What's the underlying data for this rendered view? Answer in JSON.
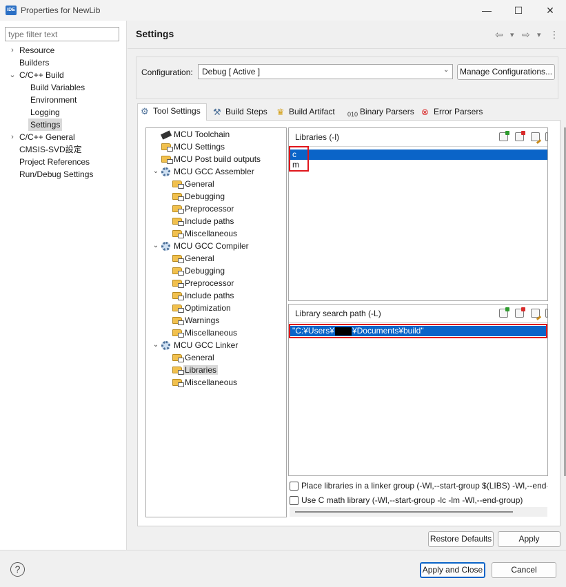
{
  "window": {
    "app_icon_text": "IDE",
    "title": "Properties for NewLib",
    "minimize_glyph": "—",
    "maximize_glyph": "☐",
    "close_glyph": "✕"
  },
  "filter": {
    "placeholder": "type filter text"
  },
  "nav": {
    "items": [
      {
        "label": "Resource",
        "arrow": "›"
      },
      {
        "label": "Builders",
        "arrow": ""
      },
      {
        "label": "C/C++ Build",
        "arrow": "⌄"
      },
      {
        "label": "Build Variables",
        "arrow": ""
      },
      {
        "label": "Environment",
        "arrow": ""
      },
      {
        "label": "Logging",
        "arrow": ""
      },
      {
        "label": "Settings",
        "arrow": ""
      },
      {
        "label": "C/C++ General",
        "arrow": "›"
      },
      {
        "label": "CMSIS-SVD設定",
        "arrow": ""
      },
      {
        "label": "Project References",
        "arrow": ""
      },
      {
        "label": "Run/Debug Settings",
        "arrow": ""
      }
    ]
  },
  "header": {
    "title": "Settings",
    "back_glyph": "⇦",
    "forward_glyph": "⇨",
    "dropdown_glyph": "▾",
    "menu_glyph": "⋮"
  },
  "configuration": {
    "label": "Configuration:",
    "value": "Debug  [ Active ]",
    "manage_button": "Manage Configurations..."
  },
  "tabs": [
    {
      "label": "Tool Settings",
      "icon": "gear-icon"
    },
    {
      "label": "Build Steps",
      "icon": "hammer-icon"
    },
    {
      "label": "Build Artifact",
      "icon": "trophy-icon"
    },
    {
      "label": "Binary Parsers",
      "icon": "binary-icon"
    },
    {
      "label": "Error Parsers",
      "icon": "error-icon"
    }
  ],
  "tree": {
    "items": [
      {
        "label": "MCU Toolchain",
        "icon": "chip-icon"
      },
      {
        "label": "MCU Settings",
        "icon": "folder-icon"
      },
      {
        "label": "MCU Post build outputs",
        "icon": "folder-icon"
      },
      {
        "label": "MCU GCC Assembler",
        "icon": "gear-icon"
      },
      {
        "label": "General",
        "icon": "folder-icon"
      },
      {
        "label": "Debugging",
        "icon": "folder-icon"
      },
      {
        "label": "Preprocessor",
        "icon": "folder-icon"
      },
      {
        "label": "Include paths",
        "icon": "folder-icon"
      },
      {
        "label": "Miscellaneous",
        "icon": "folder-icon"
      },
      {
        "label": "MCU GCC Compiler",
        "icon": "gear-icon"
      },
      {
        "label": "General",
        "icon": "folder-icon"
      },
      {
        "label": "Debugging",
        "icon": "folder-icon"
      },
      {
        "label": "Preprocessor",
        "icon": "folder-icon"
      },
      {
        "label": "Include paths",
        "icon": "folder-icon"
      },
      {
        "label": "Optimization",
        "icon": "folder-icon"
      },
      {
        "label": "Warnings",
        "icon": "folder-icon"
      },
      {
        "label": "Miscellaneous",
        "icon": "folder-icon"
      },
      {
        "label": "MCU GCC Linker",
        "icon": "gear-icon"
      },
      {
        "label": "General",
        "icon": "folder-icon"
      },
      {
        "label": "Libraries",
        "icon": "folder-icon"
      },
      {
        "label": "Miscellaneous",
        "icon": "folder-icon"
      }
    ]
  },
  "libraries": {
    "title": "Libraries (-l)",
    "items": [
      "c",
      "m"
    ]
  },
  "library_search_path": {
    "title": "Library search path (-L)",
    "path_prefix": "\"C:¥Users¥",
    "path_suffix": "¥Documents¥build\""
  },
  "options": {
    "linker_group": "Place libraries in a linker group (-Wl,--start-group $(LIBS) -Wl,--end-group)",
    "use_c_math": "Use C math library (-Wl,--start-group -lc -lm -Wl,--end-group)"
  },
  "buttons": {
    "restore_defaults": "Restore Defaults",
    "apply": "Apply",
    "apply_and_close": "Apply and Close",
    "cancel": "Cancel",
    "help": "?"
  }
}
